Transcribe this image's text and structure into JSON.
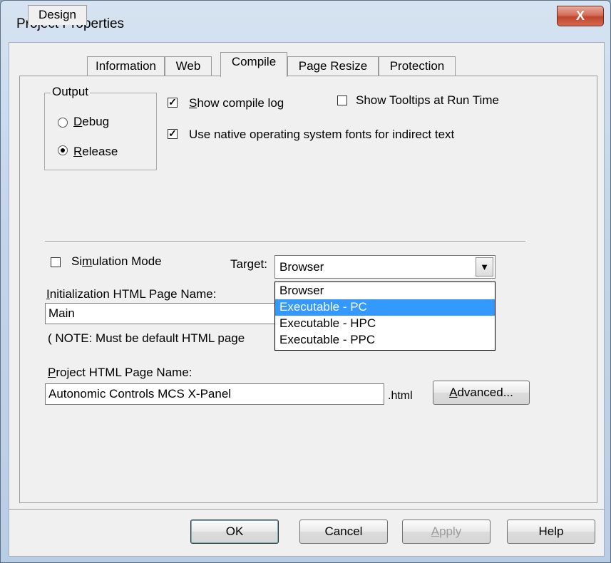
{
  "window": {
    "title": "Project Properties",
    "close_glyph": "X"
  },
  "tabs": [
    {
      "label": "Design"
    },
    {
      "label": "Information"
    },
    {
      "label": "Web"
    },
    {
      "label": "Compile",
      "active": true
    },
    {
      "label": "Page Resize"
    },
    {
      "label": "Protection"
    }
  ],
  "output": {
    "group_label": "Output",
    "debug_label": "Debug",
    "release_label": "Release",
    "selected": "Release"
  },
  "options": {
    "show_compile_log": {
      "label": "Show compile log",
      "checked": true
    },
    "show_tooltips": {
      "label": "Show Tooltips at Run Time",
      "checked": false
    },
    "native_fonts": {
      "label": "Use native operating system fonts for indirect text",
      "checked": true
    },
    "simulation_mode": {
      "label": "Simulation Mode",
      "checked": false
    }
  },
  "target": {
    "label": "Target:",
    "value": "Browser",
    "options": [
      "Browser",
      "Executable - PC",
      "Executable - HPC",
      "Executable - PPC"
    ],
    "highlighted": "Executable - PC"
  },
  "init_page": {
    "label": "Initialization HTML Page Name:",
    "value": "Main",
    "note": "( NOTE: Must be default HTML page"
  },
  "project_page": {
    "label": "Project HTML Page Name:",
    "value": "Autonomic Controls MCS X-Panel",
    "suffix": ".html",
    "advanced_label": "Advanced..."
  },
  "buttons": {
    "ok": "OK",
    "cancel": "Cancel",
    "apply": "Apply",
    "help": "Help"
  },
  "colors": {
    "selection": "#3399ff",
    "close_button": "#c1452e"
  }
}
